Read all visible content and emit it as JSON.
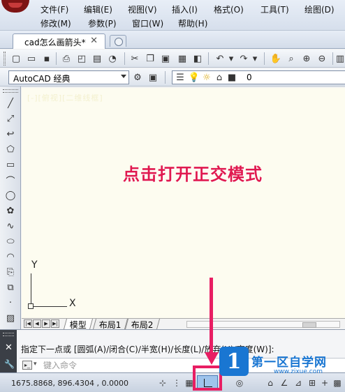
{
  "menubar": {
    "row1": [
      "文件(F)",
      "编辑(E)",
      "视图(V)",
      "插入(I)",
      "格式(O)",
      "工具(T)",
      "绘图(D)"
    ],
    "row2": [
      "修改(M)",
      "参数(P)",
      "窗口(W)",
      "帮助(H)"
    ]
  },
  "tabs": {
    "document": "cad怎么画箭头*",
    "close": "✕"
  },
  "workspace": {
    "selected": "AutoCAD 经典"
  },
  "layer": {
    "selected": "0"
  },
  "canvas": {
    "title": "[-][俯视][二维线框]",
    "ucs_x": "X",
    "ucs_y": "Y",
    "annotation": "点击打开正交模式"
  },
  "layout_tabs": [
    "模型",
    "布局1",
    "布局2"
  ],
  "command": {
    "history": "指定下一点或 [圆弧(A)/闭合(C)/半宽(H)/长度(L)/放弃(U)/宽度(W)]:",
    "placeholder": "键入命令"
  },
  "status": {
    "coords": "1675.8868, 896.4304 , 0.0000"
  },
  "watermark": {
    "badge": "1",
    "text": "第一区自学网",
    "url": "www.zixue.com"
  },
  "icons": {
    "toolbar": [
      "new-icon",
      "open-icon",
      "save-icon",
      "print-icon",
      "preview-icon",
      "plot-icon",
      "publish-icon",
      "cut-icon",
      "copy-icon",
      "paste-icon",
      "matchprop-icon",
      "blockeditor-icon",
      "undo-icon",
      "redo-icon",
      "pan-icon",
      "zoom-realtime-icon",
      "zoom-window-icon",
      "zoom-previous-icon"
    ],
    "left": [
      "line-icon",
      "construction-line-icon",
      "polyline-icon",
      "polygon-icon",
      "rectangle-icon",
      "arc-icon",
      "circle-icon",
      "revcloud-icon",
      "spline-icon",
      "ellipse-icon",
      "ellipse-arc-icon",
      "insert-block-icon",
      "make-block-icon",
      "point-icon",
      "hatch-icon"
    ]
  },
  "colors": {
    "annotation": "#e0194f",
    "highlight": "#e81e63",
    "canvas": "#fdfcf0",
    "watermark": "#1976d2"
  }
}
